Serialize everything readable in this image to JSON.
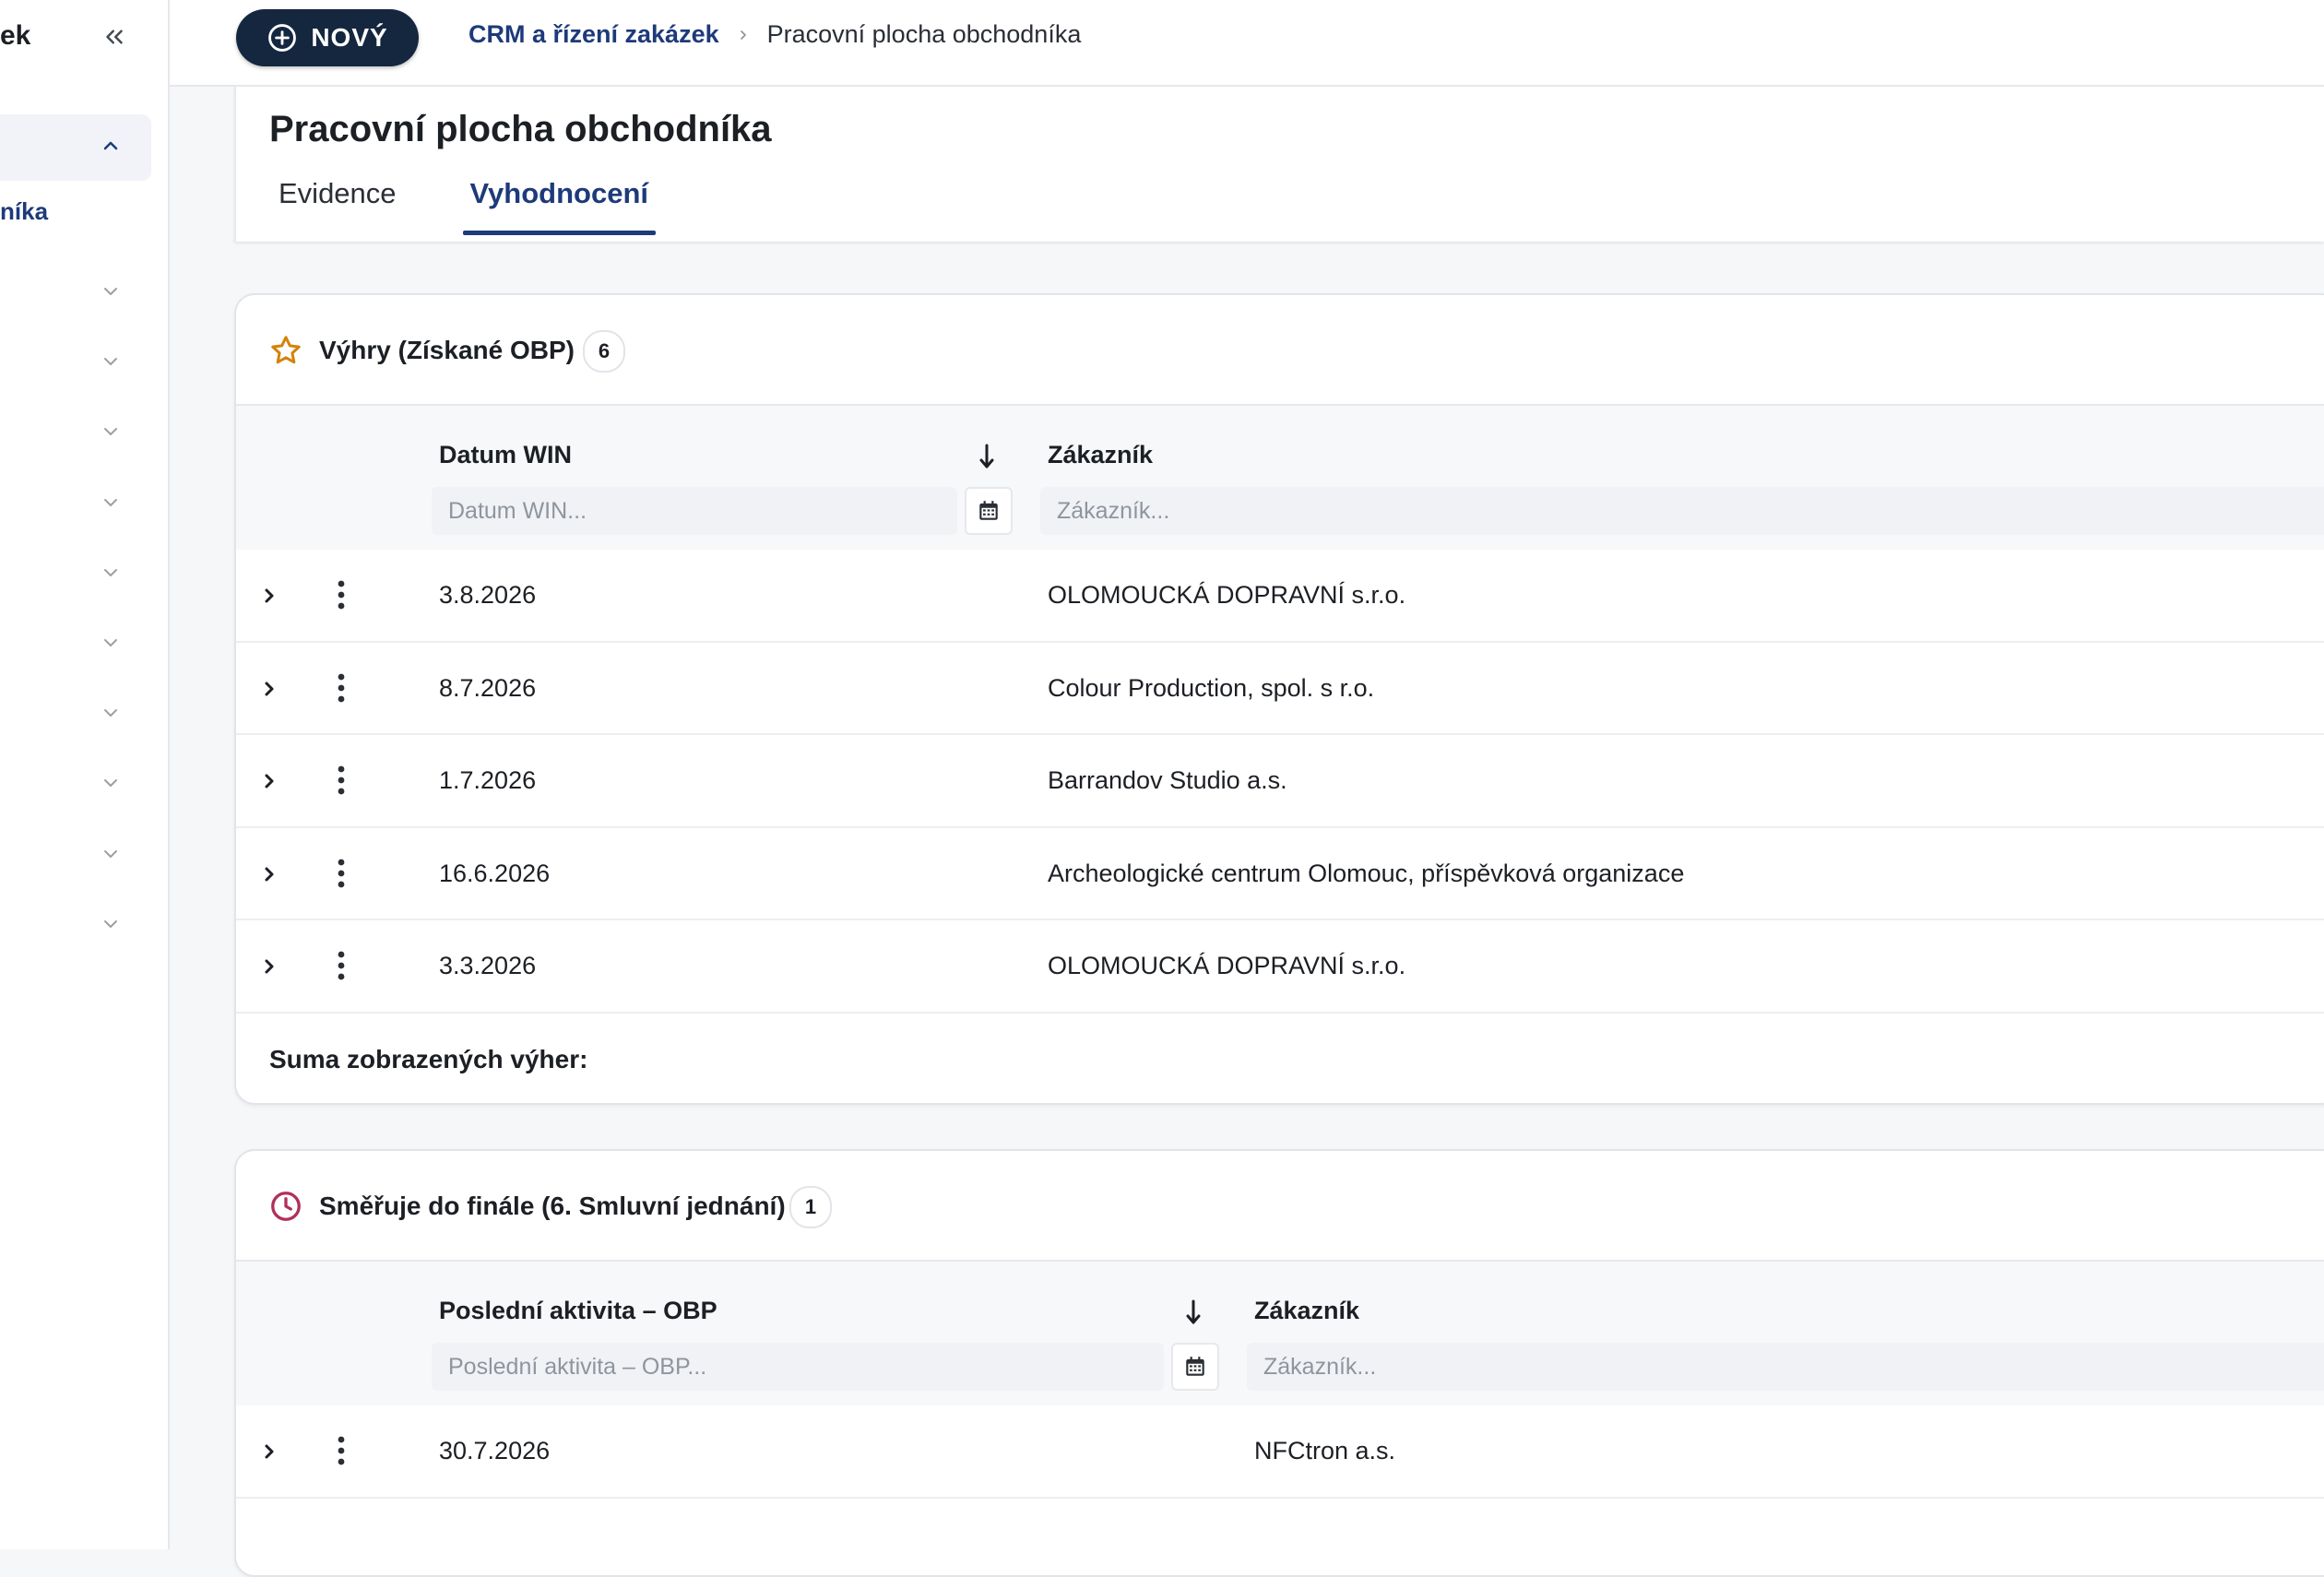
{
  "sidebar": {
    "brand": "ek",
    "active_item": "níka"
  },
  "topbar": {
    "new_button": "NOVÝ",
    "breadcrumb": {
      "parent": "CRM a řízení zakázek",
      "current": "Pracovní plocha obchodníka"
    }
  },
  "page": {
    "title": "Pracovní plocha obchodníka",
    "tabs": [
      {
        "label": "Evidence",
        "active": false
      },
      {
        "label": "Vyhodnocení",
        "active": true
      }
    ]
  },
  "wins": {
    "title": "Výhry (Získané OBP)",
    "count": "6",
    "columns": {
      "date": "Datum WIN",
      "customer": "Zákazník"
    },
    "filters": {
      "date_placeholder": "Datum WIN...",
      "customer_placeholder": "Zákazník..."
    },
    "rows": [
      {
        "date": "3.8.2026",
        "customer": "OLOMOUCKÁ DOPRAVNÍ s.r.o."
      },
      {
        "date": "8.7.2026",
        "customer": "Colour Production, spol. s r.o."
      },
      {
        "date": "1.7.2026",
        "customer": "Barrandov Studio a.s."
      },
      {
        "date": "16.6.2026",
        "customer": "Archeologické centrum Olomouc, příspěvková organizace"
      },
      {
        "date": "3.3.2026",
        "customer": "OLOMOUCKÁ DOPRAVNÍ s.r.o."
      }
    ],
    "sum_label": "Suma zobrazených výher:"
  },
  "final": {
    "title": "Směřuje do finále (6. Smluvní jednání)",
    "count": "1",
    "columns": {
      "last_activity": "Poslední aktivita – OBP",
      "customer": "Zákazník"
    },
    "filters": {
      "last_activity_placeholder": "Poslední aktivita – OBP...",
      "customer_placeholder": "Zákazník..."
    },
    "rows": [
      {
        "date": "30.7.2026",
        "customer": "NFCtron a.s."
      }
    ]
  },
  "colors": {
    "primary": "#1d3a7a",
    "button_dark": "#15263f",
    "star": "#d4820a",
    "clock": "#b0305a"
  },
  "icons": [
    "chevrons-left-icon",
    "chevron-up-icon",
    "chevron-down-icon",
    "plus-circle-icon",
    "chevron-right-icon",
    "star-icon",
    "clock-icon",
    "arrow-down-icon",
    "calendar-icon",
    "kebab-menu-icon"
  ]
}
